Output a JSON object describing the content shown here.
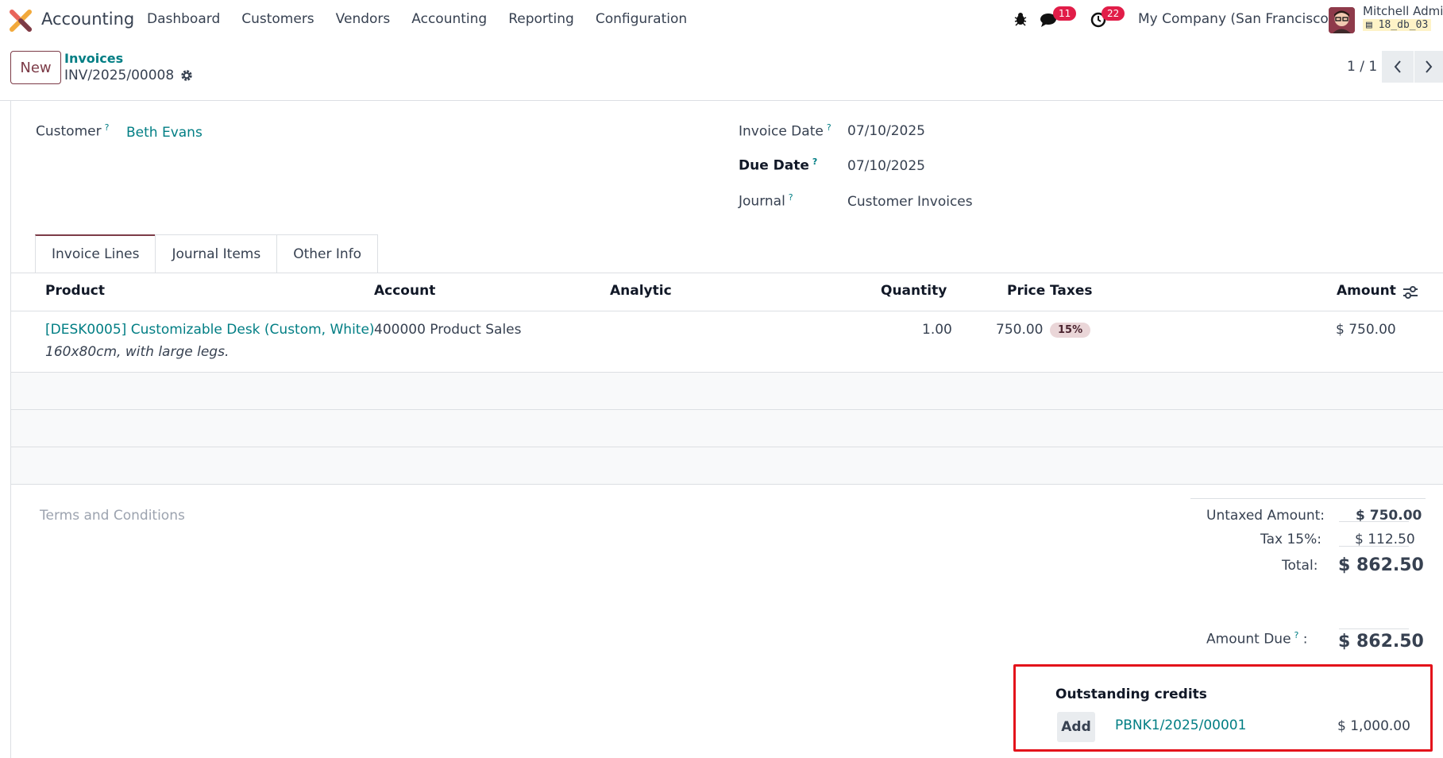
{
  "app": {
    "name": "Accounting"
  },
  "menu": [
    "Dashboard",
    "Customers",
    "Vendors",
    "Accounting",
    "Reporting",
    "Configuration"
  ],
  "systray": {
    "messages_count": "11",
    "activities_count": "22",
    "company": "My Company (San Francisco)",
    "user": "Mitchell Admin",
    "db": "18_db_03"
  },
  "control": {
    "new_label": "New",
    "breadcrumb": "Invoices",
    "record": "INV/2025/00008",
    "pager": "1 / 1"
  },
  "form": {
    "customer_label": "Customer",
    "customer_value": "Beth Evans",
    "invoice_date_label": "Invoice Date",
    "invoice_date_value": "07/10/2025",
    "due_date_label": "Due Date",
    "due_date_value": "07/10/2025",
    "journal_label": "Journal",
    "journal_value": "Customer Invoices",
    "help_mark": "?"
  },
  "tabs": [
    "Invoice Lines",
    "Journal Items",
    "Other Info"
  ],
  "table": {
    "headers": {
      "product": "Product",
      "account": "Account",
      "analytic": "Analytic",
      "quantity": "Quantity",
      "price": "Price",
      "taxes": "Taxes",
      "amount": "Amount"
    },
    "rows": [
      {
        "product": "[DESK0005] Customizable Desk (Custom, White)",
        "description": "160x80cm, with large legs.",
        "account": "400000 Product Sales",
        "quantity": "1.00",
        "price": "750.00",
        "tax": "15%",
        "amount": "$ 750.00"
      }
    ]
  },
  "terms_placeholder": "Terms and Conditions",
  "totals": {
    "untaxed_label": "Untaxed Amount:",
    "untaxed_value": "$ 750.00",
    "tax_label": "Tax 15%:",
    "tax_value": "$ 112.50",
    "total_label": "Total:",
    "total_value": "$ 862.50",
    "amount_due_label": "Amount Due",
    "amount_due_value": "$ 862.50"
  },
  "outstanding": {
    "title": "Outstanding credits",
    "add_label": "Add",
    "reference": "PBNK1/2025/00001",
    "amount": "$ 1,000.00"
  }
}
